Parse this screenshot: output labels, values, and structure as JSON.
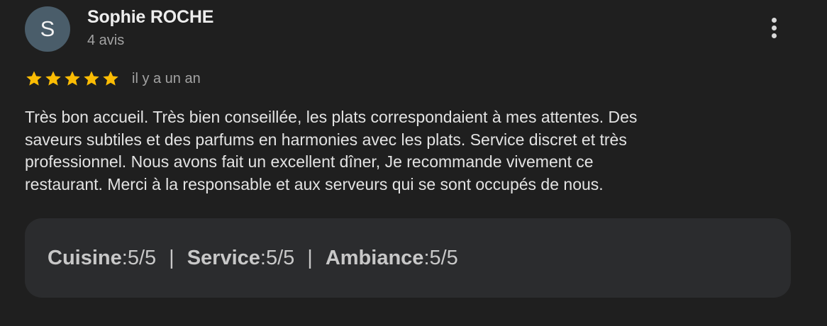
{
  "author": {
    "initial": "S",
    "name": "Sophie ROCHE",
    "review_count": "4 avis",
    "avatar_color": "#4a5d6a"
  },
  "rating": {
    "stars": 5,
    "max_stars": 5,
    "star_color": "#fbbc04",
    "time_ago": "il y a un an"
  },
  "review": {
    "lines": [
      "Très bon accueil. Très bien conseillée, les plats correspondaient à mes attentes. Des",
      "saveurs subtiles et des parfums en harmonies avec les plats. Service discret et très",
      "professionnel. Nous avons fait un excellent dîner, Je recommande vivement ce",
      "restaurant. Merci à la responsable et aux serveurs qui se sont occupés de nous."
    ]
  },
  "attributes": [
    {
      "label": "Cuisine",
      "separator": " : ",
      "value": "5/5"
    },
    {
      "label": "Service",
      "separator": " : ",
      "value": "5/5"
    },
    {
      "label": "Ambiance",
      "separator": " : ",
      "value": "5/5"
    }
  ],
  "attribute_divider": "|",
  "icons": {
    "menu": "more-vert-icon",
    "star": "star-icon"
  }
}
